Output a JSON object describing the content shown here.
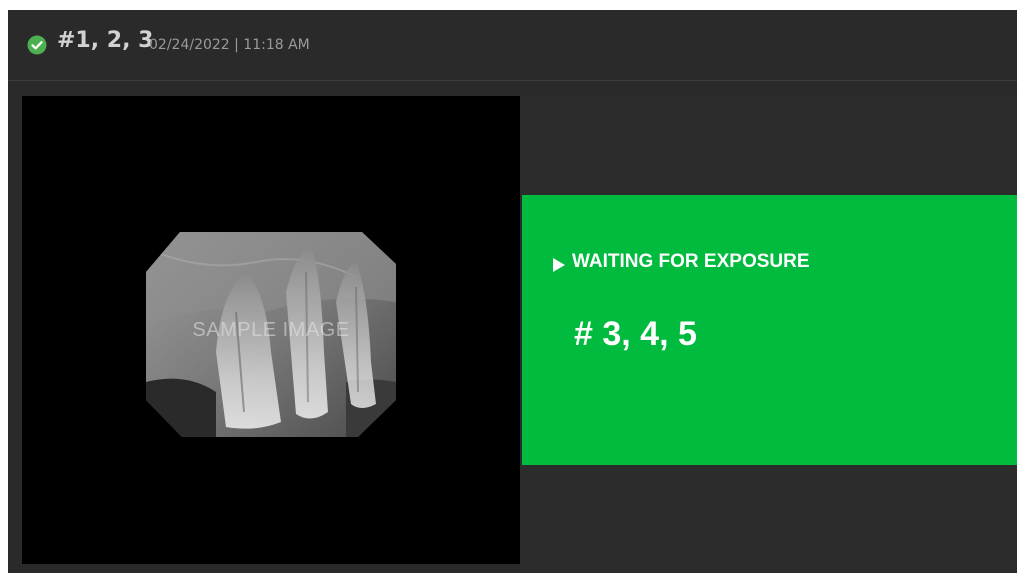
{
  "header": {
    "status_icon": "check-circle-icon",
    "tooth_numbers": "#1, 2, 3",
    "datetime": "02/24/2022 | 11:18 AM"
  },
  "image": {
    "watermark": "SAMPLE IMAGE"
  },
  "status": {
    "icon": "play-icon",
    "label": "WAITING FOR EXPOSURE",
    "tooth_numbers": "# 3, 4, 5"
  },
  "colors": {
    "success": "#4caf50",
    "status_background": "#00bb3d",
    "panel_background": "#2a2a2a",
    "image_background": "#000000"
  }
}
